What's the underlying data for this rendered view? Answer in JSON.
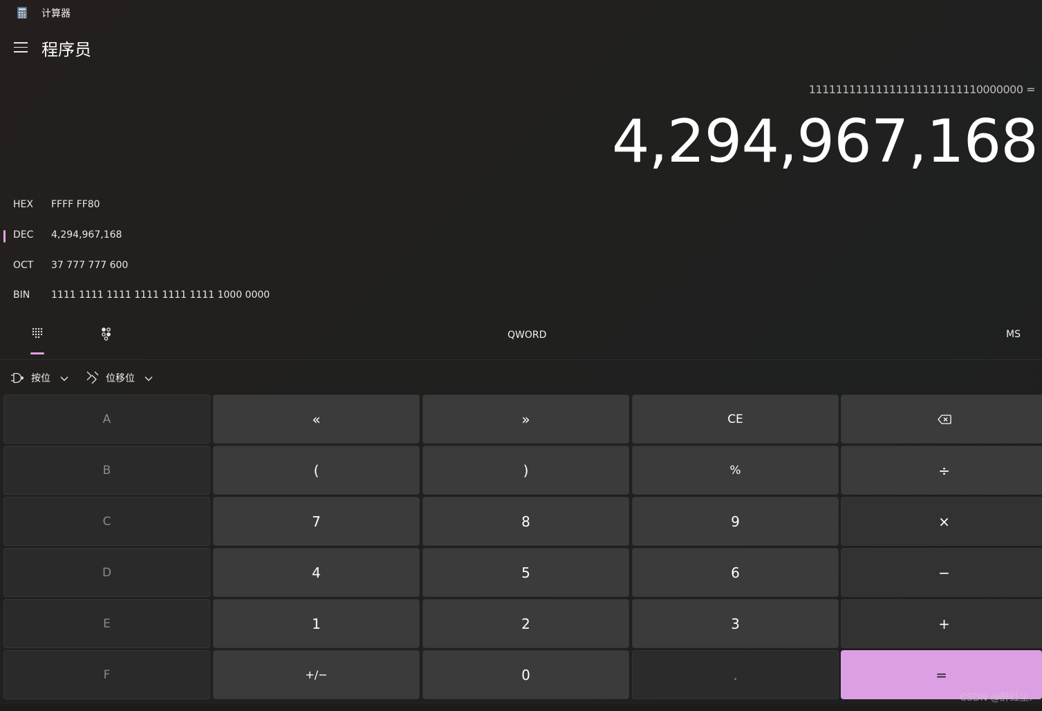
{
  "window": {
    "title": "计算器",
    "icon": "calculator-icon"
  },
  "header": {
    "mode": "程序员",
    "menu_icon": "hamburger-icon"
  },
  "display": {
    "expression": "11111111111111111111111110000000 =",
    "result": "4,294,967,168"
  },
  "radix": [
    {
      "label": "HEX",
      "value": "FFFF FF80",
      "selected": false
    },
    {
      "label": "DEC",
      "value": "4,294,967,168",
      "selected": true
    },
    {
      "label": "OCT",
      "value": "37 777 777 600",
      "selected": false
    },
    {
      "label": "BIN",
      "value": "1111 1111 1111 1111 1111 1111 1000 0000",
      "selected": false
    }
  ],
  "toolbar": {
    "keypad_icon": "full-keypad-icon",
    "bit_toggle_icon": "bit-toggling-keypad-icon",
    "word_size": "QWORD",
    "memory_store": "MS"
  },
  "dropdowns": {
    "bitwise": {
      "label": "按位",
      "icon": "logic-gate-icon"
    },
    "bitshift": {
      "label": "位移位",
      "icon": "bit-shift-icon"
    }
  },
  "keys": {
    "row1": [
      "A",
      "«",
      "»",
      "CE",
      "backspace-icon"
    ],
    "row2": [
      "B",
      "(",
      ")",
      "%",
      "÷"
    ],
    "row3": [
      "C",
      "7",
      "8",
      "9",
      "×"
    ],
    "row4": [
      "D",
      "4",
      "5",
      "6",
      "−"
    ],
    "row5": [
      "E",
      "1",
      "2",
      "3",
      "+"
    ],
    "row6": [
      "F",
      "+/−",
      "0",
      ".",
      "="
    ]
  },
  "accent_color": "#dd9fe3",
  "watermark": "CSDN @醉红尘."
}
